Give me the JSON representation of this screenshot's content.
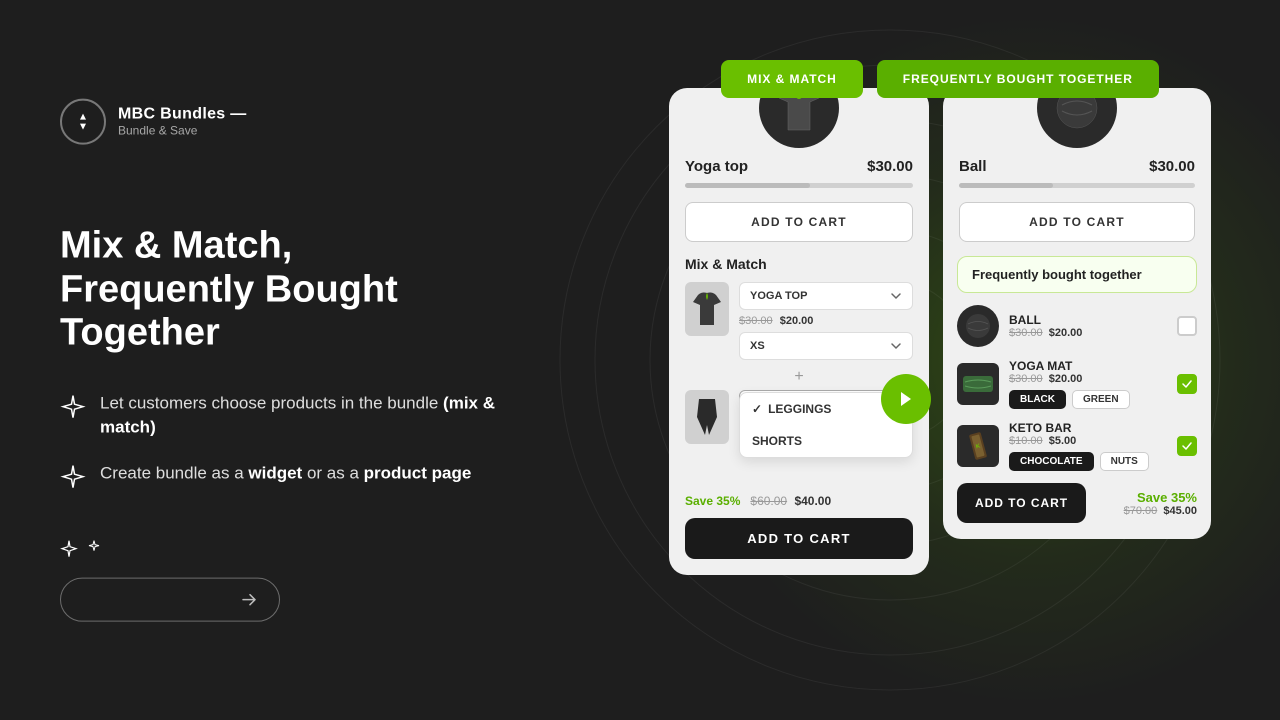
{
  "brand": {
    "name": "MBC Bundles —",
    "tagline": "Bundle & Save"
  },
  "hero": {
    "heading_line1": "Mix & Match,",
    "heading_line2": "Frequently Bought Together",
    "features": [
      {
        "text_plain": "Let customers choose products in the bundle ",
        "text_bold": "(mix & match)"
      },
      {
        "text_plain": "Create bundle as a ",
        "text_bold": "widget",
        "text_plain2": " or as a ",
        "text_bold2": "product page"
      }
    ]
  },
  "tabs": {
    "tab1": "MIX & MATCH",
    "tab2": "FREQUENTLY BOUGHT TOGETHER"
  },
  "mix_match_card": {
    "product_name": "Yoga top",
    "price": "$30.00",
    "add_to_cart": "ADD TO CART",
    "section_label": "Mix & Match",
    "items": [
      {
        "name": "YOGA TOP",
        "old_price": "$30.00",
        "new_price": "$20.00",
        "size": "XS"
      },
      {
        "name": "LEGGINGS",
        "options": [
          "LEGGINGS",
          "SHORTS"
        ],
        "selected": "LEGGINGS"
      }
    ],
    "save_pct": "Save 35%",
    "old_total": "$60.00",
    "new_total": "$40.00",
    "add_to_cart_dark": "ADD TO CART"
  },
  "fbt_card": {
    "product_name": "Ball",
    "price": "$30.00",
    "add_to_cart": "ADD TO CART",
    "section_label": "Frequently bought together",
    "items": [
      {
        "name": "BALL",
        "old_price": "$30.00",
        "new_price": "$20.00",
        "checked": false
      },
      {
        "name": "YOGA MAT",
        "old_price": "$30.00",
        "new_price": "$20.00",
        "checked": true,
        "options": [
          "BLACK",
          "GREEN"
        ]
      },
      {
        "name": "KETO BAR",
        "old_price": "$10.00",
        "new_price": "$5.00",
        "checked": true,
        "options": [
          "CHOCOLATE",
          "NUTS"
        ]
      }
    ],
    "add_to_cart_label": "ADD TO CART",
    "save_pct": "Save 35%",
    "old_total": "$70.00",
    "new_total": "$45.00"
  }
}
